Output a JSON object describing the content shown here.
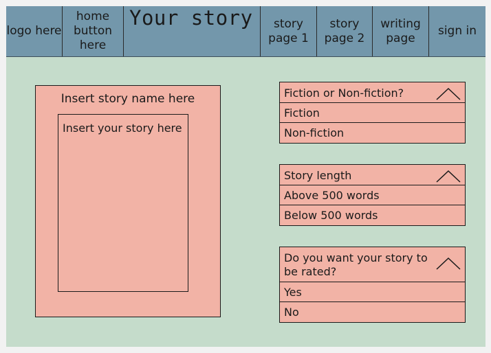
{
  "nav": {
    "logo": "logo here",
    "home": "home button here",
    "title": "Your story",
    "page1": "story page 1",
    "page2": "story page 2",
    "writing": "writing page",
    "signin": "sign in"
  },
  "story": {
    "name_placeholder": "Insert story name here",
    "body_placeholder": "Insert your story here"
  },
  "dropdowns": [
    {
      "label": "Fiction or Non-fiction?",
      "options": [
        "Fiction",
        "Non-fiction"
      ]
    },
    {
      "label": "Story length",
      "options": [
        "Above 500 words",
        "Below 500 words"
      ]
    },
    {
      "label": "Do you want your story to be rated?",
      "options": [
        "Yes",
        "No"
      ]
    }
  ],
  "icons": {
    "dropdown_toggle": "chevron-up-icon"
  },
  "colors": {
    "nav": "#7397ab",
    "background": "#c5dccb",
    "panel": "#f2b3a6"
  }
}
